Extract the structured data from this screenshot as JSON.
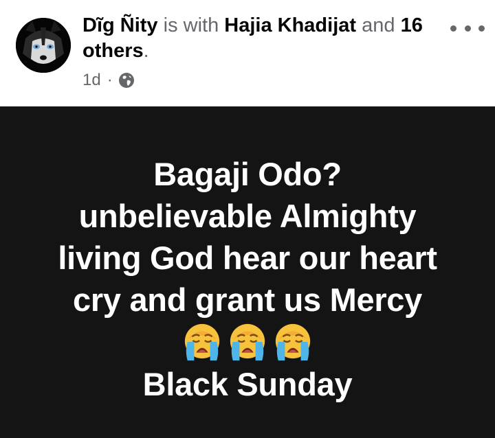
{
  "post": {
    "author": "Dĩg Ñity",
    "with_text": "is with",
    "tagged_person": "Hajia Khadijat",
    "and_text": "and",
    "others_text": "16 others",
    "period": ".",
    "time": "1d",
    "separator": "·",
    "privacy_icon": "globe-icon",
    "more_icon": "more-options-icon"
  },
  "card": {
    "background": "#141414",
    "text_color": "#ffffff",
    "lines": [
      "Bagaji Odo?",
      "unbelievable Almighty",
      "living God hear our heart",
      "cry and grant us Mercy"
    ],
    "emojis": [
      "crying-face-emoji",
      "crying-face-emoji",
      "crying-face-emoji"
    ],
    "last_line": "Black Sunday"
  }
}
